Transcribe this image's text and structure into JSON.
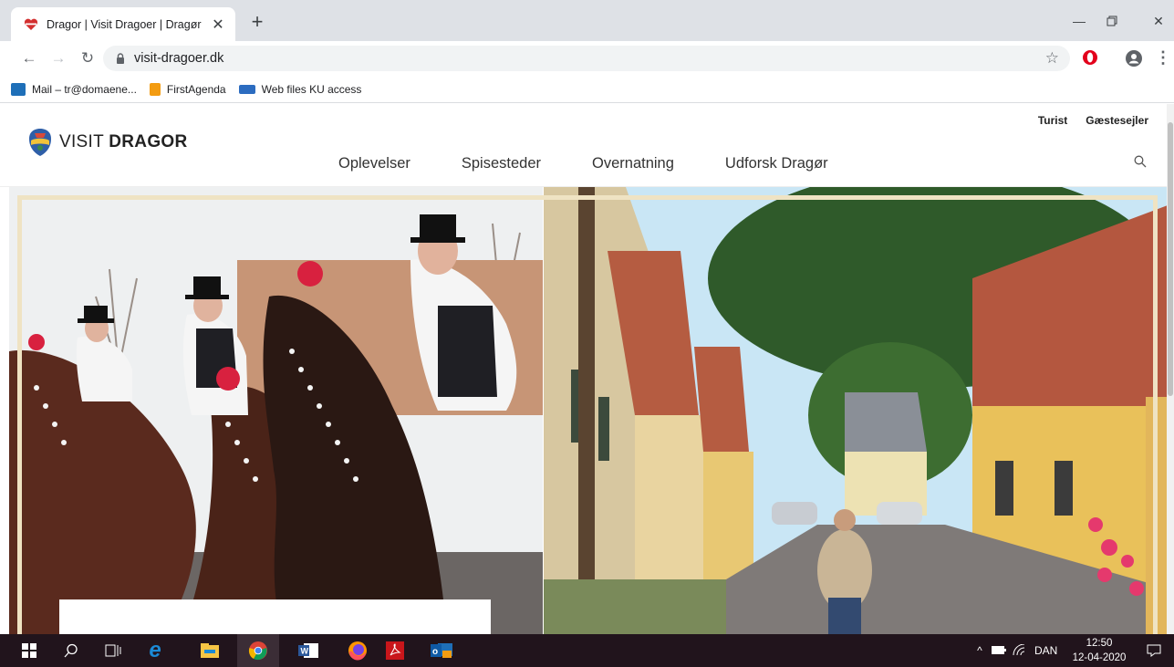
{
  "browser": {
    "tab_title": "Dragor | Visit Dragoer | Dragør",
    "url": "visit-dragoer.dk",
    "bookmarks": [
      {
        "label": "Mail – tr@domaene...",
        "icon": "outlook-icon",
        "color": "#1e6fb8"
      },
      {
        "label": "FirstAgenda",
        "icon": "firstagenda-icon",
        "color": "#f39c12"
      },
      {
        "label": "Web files KU access",
        "icon": "ku-icon",
        "color": "#2c6cc0"
      }
    ]
  },
  "site": {
    "brand_light": "VISIT ",
    "brand_bold": "DRAGOR",
    "top_links": [
      "Turist",
      "Gæstesejler"
    ],
    "nav": [
      "Oplevelser",
      "Spisesteder",
      "Overnatning",
      "Udforsk Dragør"
    ]
  },
  "taskbar": {
    "language": "DAN",
    "time": "12:50",
    "date": "12-04-2020"
  },
  "colors": {
    "frame": "#efe3c3",
    "taskbar": "#21141c"
  }
}
